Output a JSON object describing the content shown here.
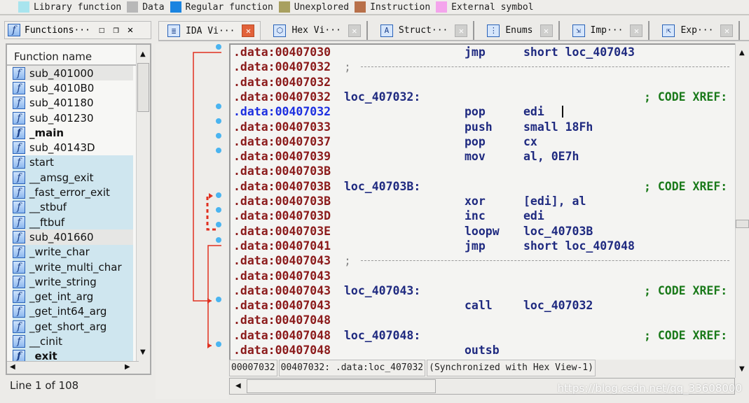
{
  "legend": [
    {
      "label": "Library function",
      "color": "#a8e4ee"
    },
    {
      "label": "Data",
      "color": "#b8b8b8"
    },
    {
      "label": "Regular function",
      "color": "#1a84e0"
    },
    {
      "label": "Unexplored",
      "color": "#a8a060"
    },
    {
      "label": "Instruction",
      "color": "#b8704a"
    },
    {
      "label": "External symbol",
      "color": "#f4a4ec"
    }
  ],
  "functions_panel": {
    "title": "Functions···",
    "column": "Function name",
    "status": "Line 1 of 108",
    "items": [
      {
        "name": "sub_401000",
        "kind": "sel"
      },
      {
        "name": "sub_4010B0",
        "kind": ""
      },
      {
        "name": "sub_401180",
        "kind": ""
      },
      {
        "name": "sub_401230",
        "kind": ""
      },
      {
        "name": "_main",
        "kind": "bold"
      },
      {
        "name": "sub_40143D",
        "kind": ""
      },
      {
        "name": "start",
        "kind": "lib"
      },
      {
        "name": "__amsg_exit",
        "kind": "lib"
      },
      {
        "name": "_fast_error_exit",
        "kind": "lib"
      },
      {
        "name": "__stbuf",
        "kind": "lib"
      },
      {
        "name": "__ftbuf",
        "kind": "lib"
      },
      {
        "name": "sub_401660",
        "kind": "sel"
      },
      {
        "name": "_write_char",
        "kind": "lib"
      },
      {
        "name": "_write_multi_char",
        "kind": "lib"
      },
      {
        "name": "_write_string",
        "kind": "lib"
      },
      {
        "name": "_get_int_arg",
        "kind": "lib"
      },
      {
        "name": "_get_int64_arg",
        "kind": "lib"
      },
      {
        "name": "_get_short_arg",
        "kind": "lib"
      },
      {
        "name": "__cinit",
        "kind": "lib"
      },
      {
        "name": "_exit",
        "kind": "lib bold"
      }
    ]
  },
  "tabs": [
    {
      "label": "IDA Vi···",
      "icon": "ida-view-icon",
      "active": true
    },
    {
      "label": "Hex Vi···",
      "icon": "hex-view-icon"
    },
    {
      "label": "Struct···",
      "icon": "structures-icon"
    },
    {
      "label": "Enums",
      "icon": "enums-icon"
    },
    {
      "label": "Imp···",
      "icon": "imports-icon"
    },
    {
      "label": "Exp···",
      "icon": "exports-icon"
    }
  ],
  "code": [
    {
      "addr": ".data:00407030",
      "mn": "jmp",
      "op": "short loc_407043"
    },
    {
      "addr": ".data:00407032",
      "sep": ";"
    },
    {
      "addr": ".data:00407032"
    },
    {
      "addr": ".data:00407032",
      "label": "loc_407032:",
      "cm": "; CODE XREF:"
    },
    {
      "addr": ".data:00407032",
      "mn": "pop",
      "op": "edi",
      "cur": true
    },
    {
      "addr": ".data:00407033",
      "mn": "push",
      "op": "small 18Fh"
    },
    {
      "addr": ".data:00407037",
      "mn": "pop",
      "op": "cx"
    },
    {
      "addr": ".data:00407039",
      "mn": "mov",
      "op": "al, 0E7h"
    },
    {
      "addr": ".data:0040703B"
    },
    {
      "addr": ".data:0040703B",
      "label": "loc_40703B:",
      "cm": "; CODE XREF:"
    },
    {
      "addr": ".data:0040703B",
      "mn": "xor",
      "op": "[edi], al"
    },
    {
      "addr": ".data:0040703D",
      "mn": "inc",
      "op": "edi"
    },
    {
      "addr": ".data:0040703E",
      "mn": "loopw",
      "op": "loc_40703B"
    },
    {
      "addr": ".data:00407041",
      "mn": "jmp",
      "op": "short loc_407048"
    },
    {
      "addr": ".data:00407043",
      "sep": ";"
    },
    {
      "addr": ".data:00407043"
    },
    {
      "addr": ".data:00407043",
      "label": "loc_407043:",
      "cm": "; CODE XREF:"
    },
    {
      "addr": ".data:00407043",
      "mn": "call",
      "op": "loc_407032"
    },
    {
      "addr": ".data:00407048"
    },
    {
      "addr": ".data:00407048",
      "label": "loc_407048:",
      "cm": "; CODE XREF:"
    },
    {
      "addr": ".data:00407048",
      "mn": "outsb"
    }
  ],
  "status": {
    "offset": "00007032",
    "location": "00407032: .data:loc_407032",
    "sync": "(Synchronized with Hex View-1)"
  },
  "watermark": "https://blog.csdn.net/qq_33608000"
}
